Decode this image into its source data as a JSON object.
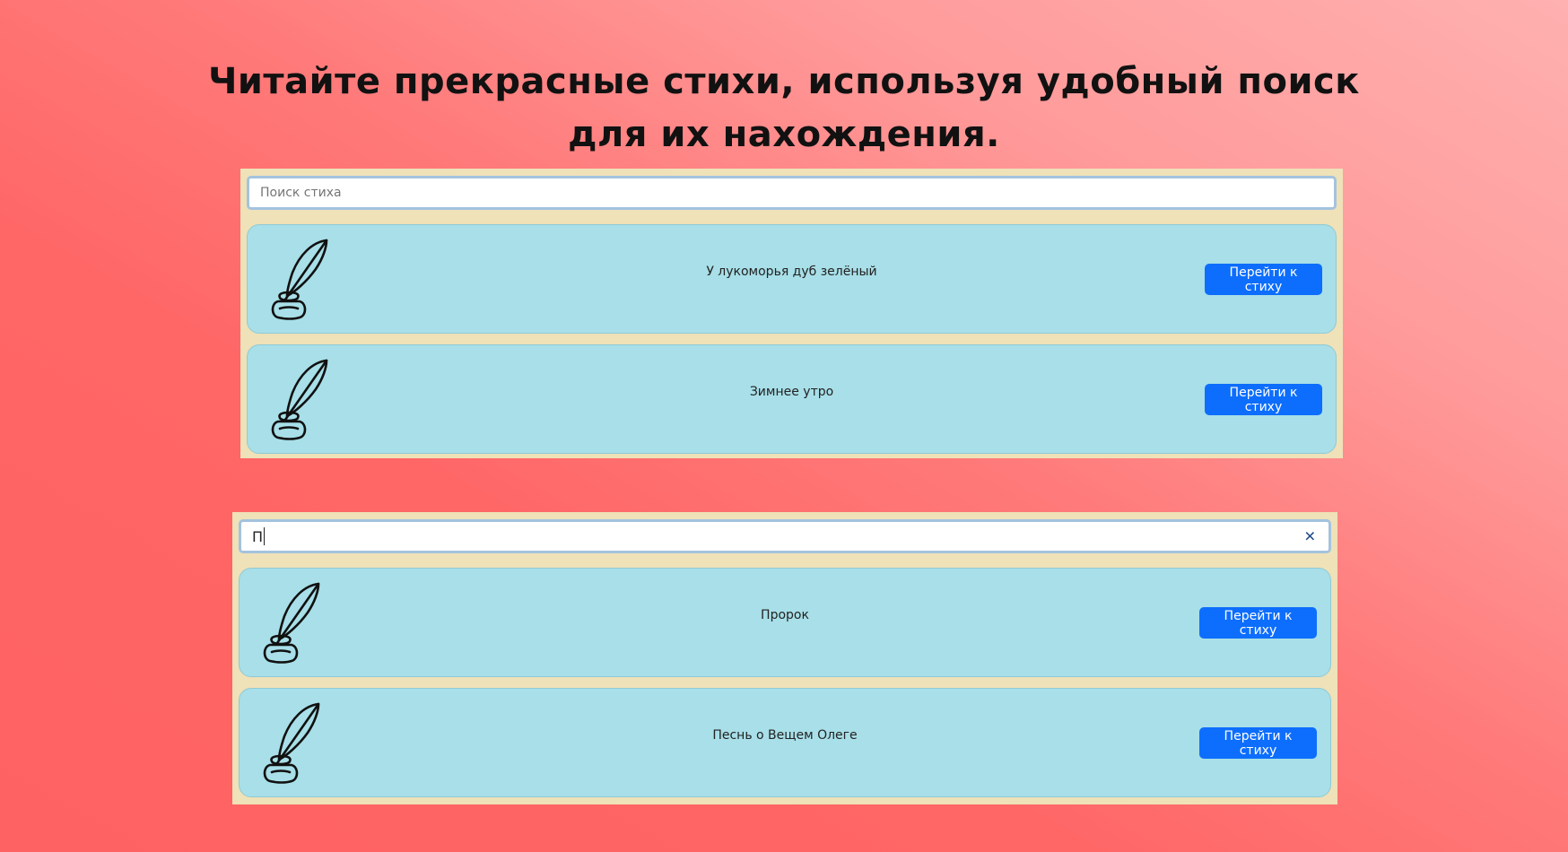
{
  "headline": "Читайте прекрасные стихи, используя удобный поиск для их нахождения.",
  "icon": "quill-inkwell-icon",
  "accent_color": "#0d6efd",
  "panel_top": {
    "search": {
      "placeholder": "Поиск стиха",
      "value": ""
    },
    "poems": [
      {
        "title": "У лукоморья дуб зелёный",
        "button": "Перейти к стиху"
      },
      {
        "title": "Зимнее утро",
        "button": "Перейти к стиху"
      }
    ]
  },
  "panel_bottom": {
    "search": {
      "placeholder": "",
      "value": "П",
      "clear_icon": "close-icon",
      "clear_glyph": "✕"
    },
    "poems": [
      {
        "title": "Пророк",
        "button": "Перейти к стиху"
      },
      {
        "title": "Песнь о Вещем Олеге",
        "button": "Перейти к стиху"
      }
    ]
  }
}
